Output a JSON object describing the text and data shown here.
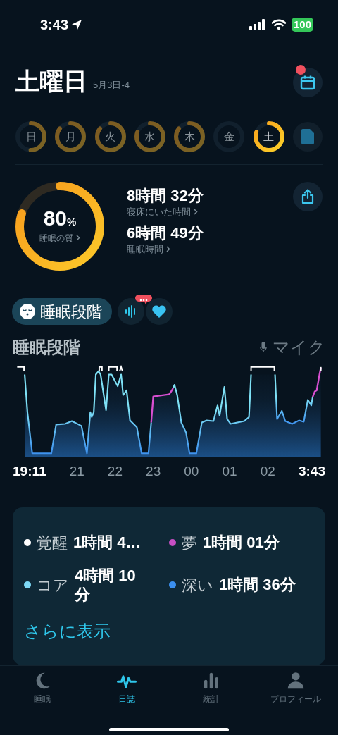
{
  "status_bar": {
    "time": "3:43",
    "battery": "100"
  },
  "header": {
    "title": "土曜日",
    "date": "5月3日-4",
    "calendar_notification": true
  },
  "days": [
    {
      "label": "日",
      "selected": false
    },
    {
      "label": "月",
      "selected": false
    },
    {
      "label": "火",
      "selected": false
    },
    {
      "label": "水",
      "selected": false
    },
    {
      "label": "木",
      "selected": false
    },
    {
      "label": "金",
      "selected": false
    },
    {
      "label": "土",
      "selected": true
    }
  ],
  "summary": {
    "score": "80",
    "score_unit": "%",
    "score_label": "睡眠の質",
    "stats": [
      {
        "value": "8時間 32分",
        "label": "寝床にいた時間"
      },
      {
        "value": "6時間 49分",
        "label": "睡眠時間"
      }
    ]
  },
  "stage_tabs": [
    {
      "label": "睡眠段階",
      "selected": true,
      "badge": false
    },
    {
      "selected": false,
      "badge": true
    },
    {
      "selected": false,
      "badge": false
    }
  ],
  "chart": {
    "title": "睡眠段階",
    "source": "マイク",
    "time_labels": [
      {
        "label": "19:11",
        "bold": true
      },
      {
        "label": "21",
        "bold": false
      },
      {
        "label": "22",
        "bold": false
      },
      {
        "label": "23",
        "bold": false
      },
      {
        "label": "00",
        "bold": false
      },
      {
        "label": "01",
        "bold": false
      },
      {
        "label": "02",
        "bold": false
      },
      {
        "label": "3:43",
        "bold": true
      }
    ]
  },
  "legend": [
    {
      "label": "覚醒",
      "value": "1時間 4…",
      "color": "#ffffff"
    },
    {
      "label": "夢",
      "value": "1時間 01分",
      "color": "#c74fc4"
    },
    {
      "label": "コア",
      "value": "4時間 10分",
      "color": "#7dd8f5"
    },
    {
      "label": "深い",
      "value": "1時間 36分",
      "color": "#3b8fef"
    }
  ],
  "more_link": "さらに表示",
  "nav": [
    {
      "label": "睡眠",
      "selected": false
    },
    {
      "label": "日誌",
      "selected": true
    },
    {
      "label": "統計",
      "selected": false
    },
    {
      "label": "プロフィール",
      "selected": false
    }
  ]
}
